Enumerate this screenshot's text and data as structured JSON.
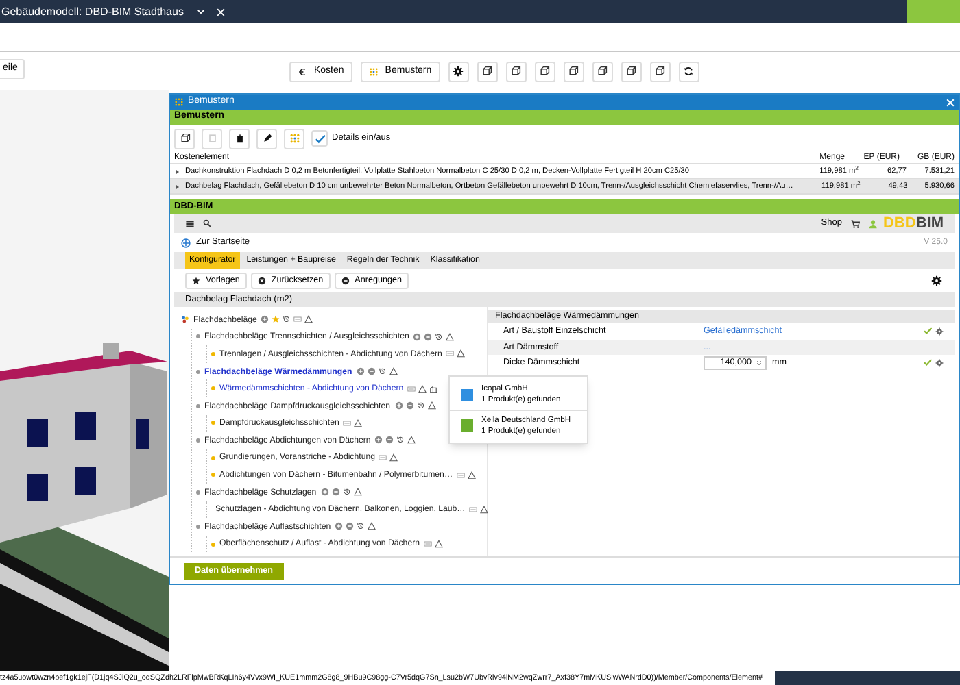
{
  "window": {
    "title": "Gebäudemodell: DBD-BIM Stadthaus"
  },
  "toolbar": {
    "left_button": "eile",
    "buttons": [
      {
        "kind": "euro",
        "label": "Kosten"
      },
      {
        "kind": "dots",
        "label": "Bemustern"
      },
      {
        "kind": "gear"
      },
      {
        "kind": "cube"
      },
      {
        "kind": "cube"
      },
      {
        "kind": "cube"
      },
      {
        "kind": "cube"
      },
      {
        "kind": "cube"
      },
      {
        "kind": "cube"
      },
      {
        "kind": "cube"
      },
      {
        "kind": "refresh"
      }
    ]
  },
  "dialog": {
    "title": "Bemustern",
    "section": "Bemustern",
    "details_toggle": {
      "label": "Details ein/aus",
      "checked": true
    },
    "table": {
      "columns": [
        "Kostenelement",
        "Menge",
        "EP (EUR)",
        "GB (EUR)"
      ],
      "rows": [
        {
          "text": "Dachkonstruktion Flachdach D 0,2 m Betonfertigteil, Vollplatte Stahlbeton Normalbeton C 25/30 D 0,2 m, Decken-Vollplatte Fertigteil H 20cm C25/30",
          "menge": "119,981 m$^{2}$",
          "ep": "62,77",
          "gb": "7.531,21",
          "selected": false
        },
        {
          "text": "Dachbelag Flachdach, Gefällebeton D 10 cm unbewehrter Beton Normalbeton, Ortbeton Gefällebeton unbewehrt D 10cm, Trenn-/Ausgleichsschicht Chemiefaservlies, Trenn-/Au…",
          "menge": "119,981 m$^{2}$",
          "ep": "49,43",
          "gb": "5.930,66",
          "selected": true
        }
      ]
    },
    "dbd": {
      "title": "DBD-BIM",
      "shop": "Shop",
      "logo_a": "DBD",
      "logo_b": "BIM",
      "home_link": "Zur Startseite",
      "version": "V 25.0",
      "tabs": [
        {
          "label": "Konfigurator",
          "selected": true
        },
        {
          "label": "Leistungen + Baupreise",
          "selected": false
        },
        {
          "label": "Regeln der Technik",
          "selected": false
        },
        {
          "label": "Klassifikation",
          "selected": false
        }
      ],
      "actions": [
        {
          "kind": "star",
          "label": "Vorlagen"
        },
        {
          "kind": "x",
          "label": "Zurücksetzen"
        },
        {
          "kind": "minus",
          "label": "Anregungen"
        }
      ],
      "section_title": "Dachbelag Flachdach (m2)",
      "tree": [
        {
          "kind": "root",
          "label": "Flachdachbeläge",
          "selected": false,
          "children": [
            {
              "kind": "group",
              "label": "Flachdachbeläge Trennschichten / Ausgleichsschichten",
              "selected": false,
              "children": [
                {
                  "kind": "leaf",
                  "label": "Trennlagen / Ausgleichsschichten - Abdichtung von Dächern",
                  "selected": false
                }
              ]
            },
            {
              "kind": "group",
              "label": "Flachdachbeläge Wärmedämmungen",
              "selected": true,
              "children": [
                {
                  "kind": "leaf",
                  "label": "Wärmedämmschichten - Abdichtung von Dächern",
                  "selected": true
                }
              ]
            },
            {
              "kind": "group",
              "label": "Flachdachbeläge Dampfdruckausgleichsschichten",
              "selected": false,
              "children": [
                {
                  "kind": "leaf",
                  "label": "Dampfdruckausgleichsschichten",
                  "selected": false
                }
              ]
            },
            {
              "kind": "group",
              "label": "Flachdachbeläge Abdichtungen von Dächern",
              "selected": false,
              "children": [
                {
                  "kind": "leaf",
                  "label": "Grundierungen, Voranstriche - Abdichtung",
                  "selected": false
                },
                {
                  "kind": "leaf",
                  "label": "Abdichtungen von Dächern - Bitumenbahn / Polymerbitumen…",
                  "selected": false
                }
              ]
            },
            {
              "kind": "group",
              "label": "Flachdachbeläge Schutzlagen",
              "selected": false,
              "children": [
                {
                  "kind": "leaf",
                  "label": "Schutzlagen - Abdichtung von Dächern, Balkonen, Loggien, Laub…",
                  "selected": false
                }
              ]
            },
            {
              "kind": "group",
              "label": "Flachdachbeläge Auflastschichten",
              "selected": false,
              "children": [
                {
                  "kind": "leaf",
                  "label": "Oberflächenschutz / Auflast - Abdichtung von Dächern",
                  "selected": false
                }
              ]
            }
          ]
        }
      ],
      "popup": [
        {
          "name": "Icopal GmbH",
          "count": "1 Produkt(e) gefunden",
          "color": "#2f8fe0"
        },
        {
          "name": "Xella Deutschland GmbH",
          "count": "1 Produkt(e) gefunden",
          "color": "#6aae2e"
        }
      ],
      "properties": {
        "title": "Flachdachbeläge Wärmedämmungen",
        "rows": [
          {
            "kind": "link",
            "label": "Art / Baustoff Einzelschicht",
            "value": "Gefälledämmschicht",
            "confirmed": true
          },
          {
            "kind": "link",
            "label": "Art Dämmstoff",
            "value": "...",
            "confirmed": false
          },
          {
            "kind": "number",
            "label": "Dicke Dämmschicht",
            "value": "140,000",
            "unit": "mm",
            "confirmed": true
          }
        ]
      }
    },
    "apply_button": "Daten übernehmen"
  },
  "status_bar": {
    "url": "tz4a5uowt0wzn4bef1gk1ejF(D1jq4SJiQ2u_oqSQZdh2LRFlpMwBRKqLIh6y4Vvx9WI_KUE1mmm2G8g8_9HBu9C98gg-C7Vr5dqG7Sn_Lsu2bW7UbvRlv94lNM2wqZwrr7_Axf38Y7mMKUSiwWANrdD0))/Member/Components/Element#"
  }
}
